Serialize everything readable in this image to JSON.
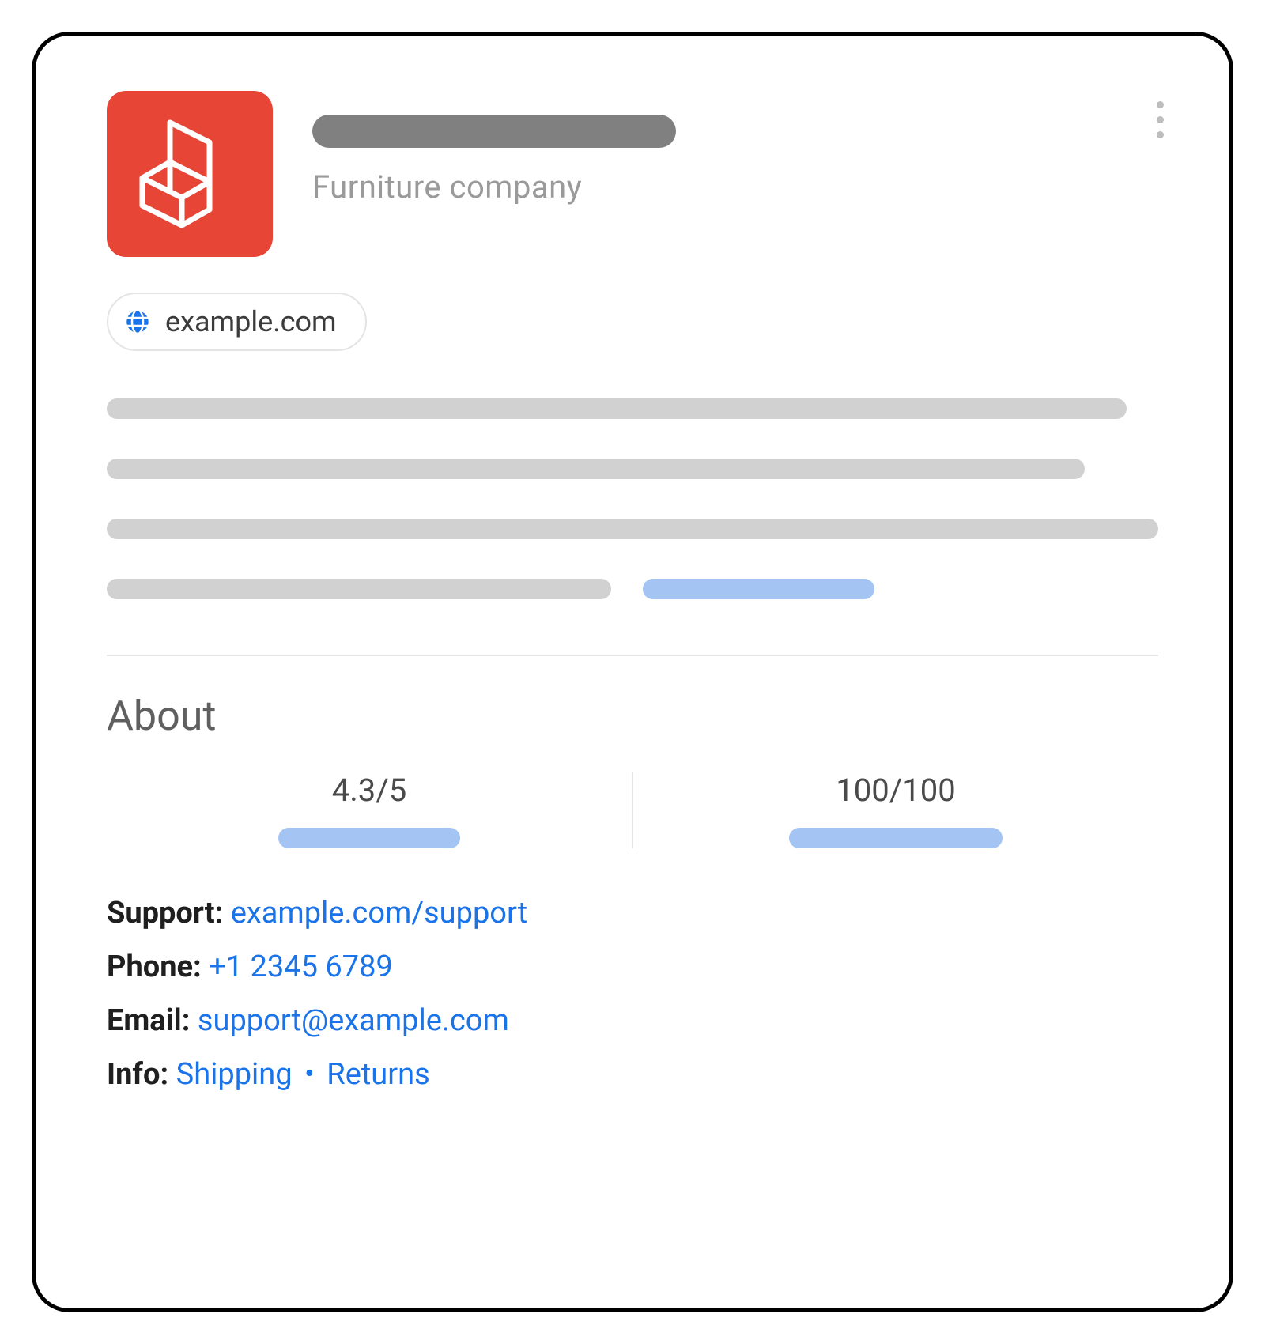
{
  "header": {
    "subtitle": "Furniture company",
    "website_label": "example.com"
  },
  "about": {
    "heading": "About",
    "score1": "4.3/5",
    "score2": "100/100"
  },
  "contact": {
    "support_label": "Support: ",
    "support_link": "example.com/support",
    "phone_label": "Phone: ",
    "phone_link": "+1 2345 6789",
    "email_label": "Email: ",
    "email_link": "support@example.com",
    "info_label": "Info: ",
    "info_link1": "Shipping",
    "info_separator": " • ",
    "info_link2": "Returns"
  }
}
